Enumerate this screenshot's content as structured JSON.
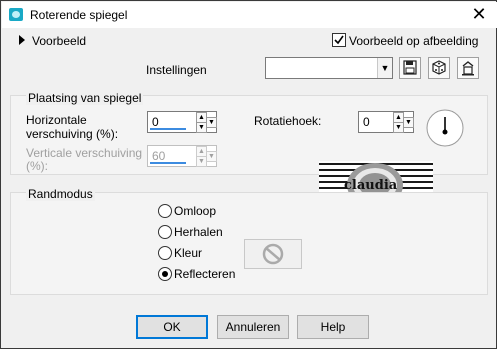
{
  "window": {
    "title": "Roterende spiegel",
    "close_glyph": "✕"
  },
  "preview": {
    "label": "Voorbeeld",
    "on_image_label": "Voorbeeld op afbeelding",
    "on_image_checked": true
  },
  "settings": {
    "label": "Instellingen",
    "value": ""
  },
  "placement": {
    "group_label": "Plaatsing van spiegel",
    "horizontal_label_line1": "Horizontale",
    "horizontal_label_line2": "verschuiving (%):",
    "horizontal_value": "0",
    "vertical_label_line1": "Verticale verschuiving",
    "vertical_label_line2": "(%):",
    "vertical_value": "60",
    "rotation_label": "Rotatiehoek:",
    "rotation_value": "0"
  },
  "preview_logo_text": "claudia",
  "edge": {
    "group_label": "Randmodus",
    "options": [
      "Omloop",
      "Herhalen",
      "Kleur",
      "Reflecteren"
    ],
    "selected": "Reflecteren"
  },
  "buttons": {
    "ok": "OK",
    "cancel": "Annuleren",
    "help": "Help"
  },
  "colors": {
    "accent": "#0078d7",
    "progress": "#3c8be0"
  }
}
